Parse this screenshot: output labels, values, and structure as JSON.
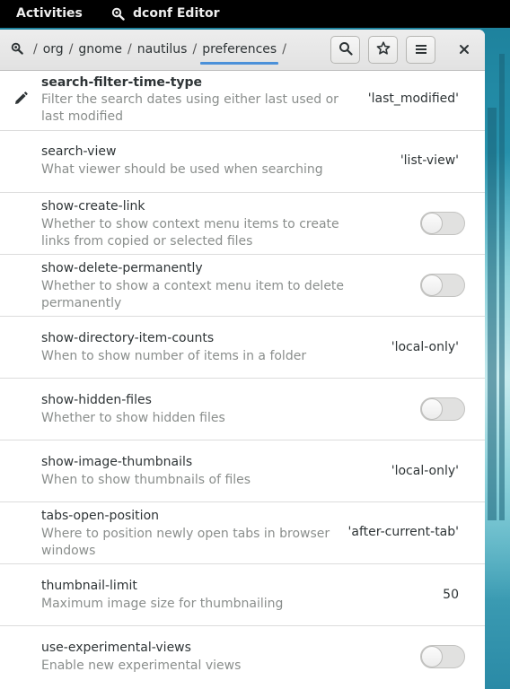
{
  "topbar": {
    "activities": "Activities",
    "app_name": "dconf Editor"
  },
  "breadcrumb": [
    "org",
    "gnome",
    "nautilus",
    "preferences"
  ],
  "breadcrumb_sep": "/",
  "colors": {
    "accent": "#4a90d9",
    "desc_text": "#8a8e8c"
  },
  "keys": [
    {
      "name": "search-filter-time-type",
      "desc": "Filter the search dates using either last used or last modified",
      "value": "'last_modified'",
      "kind": "value",
      "modified": true
    },
    {
      "name": "search-view",
      "desc": "What viewer should be used when searching",
      "value": "'list-view'",
      "kind": "value"
    },
    {
      "name": "show-create-link",
      "desc": "Whether to show context menu items to create links from copied or selected files",
      "kind": "switch",
      "state": "off"
    },
    {
      "name": "show-delete-permanently",
      "desc": "Whether to show a context menu item to delete permanently",
      "kind": "switch",
      "state": "off"
    },
    {
      "name": "show-directory-item-counts",
      "desc": "When to show number of items in a folder",
      "value": "'local-only'",
      "kind": "value"
    },
    {
      "name": "show-hidden-files",
      "desc": "Whether to show hidden files",
      "kind": "switch",
      "state": "off"
    },
    {
      "name": "show-image-thumbnails",
      "desc": "When to show thumbnails of files",
      "value": "'local-only'",
      "kind": "value"
    },
    {
      "name": "tabs-open-position",
      "desc": "Where to position newly open tabs in browser windows",
      "value": "'after-current-tab'",
      "kind": "value"
    },
    {
      "name": "thumbnail-limit",
      "desc": "Maximum image size for thumbnailing",
      "value": "50",
      "kind": "value"
    },
    {
      "name": "use-experimental-views",
      "desc": "Enable new experimental views",
      "kind": "switch",
      "state": "off"
    }
  ]
}
